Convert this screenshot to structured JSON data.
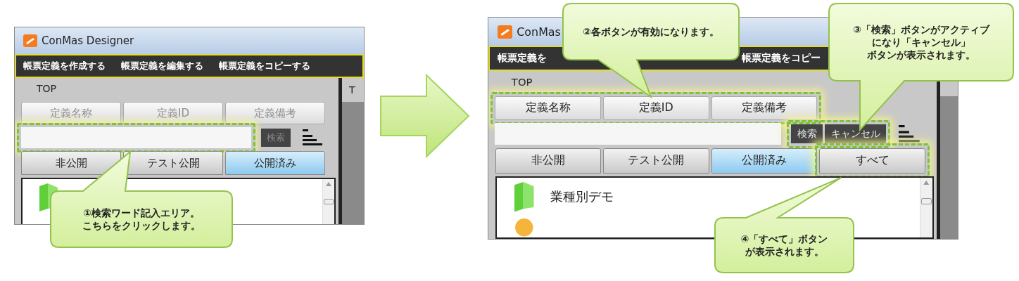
{
  "screens": [
    {
      "title": "ConMas Designer",
      "menu": [
        "帳票定義を作成する",
        "帳票定義を編集する",
        "帳票定義をコピーする"
      ],
      "breadcrumb": "TOP",
      "side_header": "T",
      "field_buttons": [
        {
          "label": "定義名称",
          "disabled": true
        },
        {
          "label": "定義ID",
          "disabled": true
        },
        {
          "label": "定義備考",
          "disabled": true
        }
      ],
      "field_buttons_highlighted": false,
      "search_field": {
        "highlighted": true
      },
      "search_buttons": [
        {
          "label": "検索",
          "disabled": true
        }
      ],
      "search_buttons_highlighted": false,
      "tabs": [
        {
          "label": "非公開",
          "selected": false
        },
        {
          "label": "テスト公開",
          "selected": false
        },
        {
          "label": "公開済み",
          "selected": true
        }
      ],
      "list_items": [
        {
          "kind": "folder"
        }
      ]
    },
    {
      "title": "ConMas",
      "menu": [
        "帳票定義を",
        "帳票定義をコピー"
      ],
      "breadcrumb": "TOP",
      "field_buttons": [
        {
          "label": "定義名称",
          "disabled": false
        },
        {
          "label": "定義ID",
          "disabled": false
        },
        {
          "label": "定義備考",
          "disabled": false
        }
      ],
      "field_buttons_highlighted": true,
      "search_field": {
        "highlighted": false
      },
      "search_buttons": [
        {
          "label": "検索",
          "disabled": false
        },
        {
          "label": "キャンセル",
          "disabled": false
        }
      ],
      "search_buttons_highlighted": true,
      "tabs": [
        {
          "label": "非公開",
          "selected": false
        },
        {
          "label": "テスト公開",
          "selected": false
        },
        {
          "label": "公開済み",
          "selected": true
        }
      ],
      "all_button": {
        "label": "すべて",
        "highlighted": true
      },
      "list_items": [
        {
          "kind": "folder",
          "label": "業種別デモ"
        },
        {
          "kind": "file"
        }
      ]
    }
  ],
  "callouts": [
    {
      "lines": [
        "①検索ワード記入エリア。",
        "こちらをクリックします。"
      ]
    },
    {
      "lines": [
        "②各ボタンが有効になります。"
      ]
    },
    {
      "lines": [
        "③「検索」ボタンがアクティブ",
        "になり「キャンセル」",
        "ボタンが表示されます。"
      ]
    },
    {
      "lines": [
        "④「すべて」ボタン",
        "が表示されます。"
      ]
    }
  ]
}
